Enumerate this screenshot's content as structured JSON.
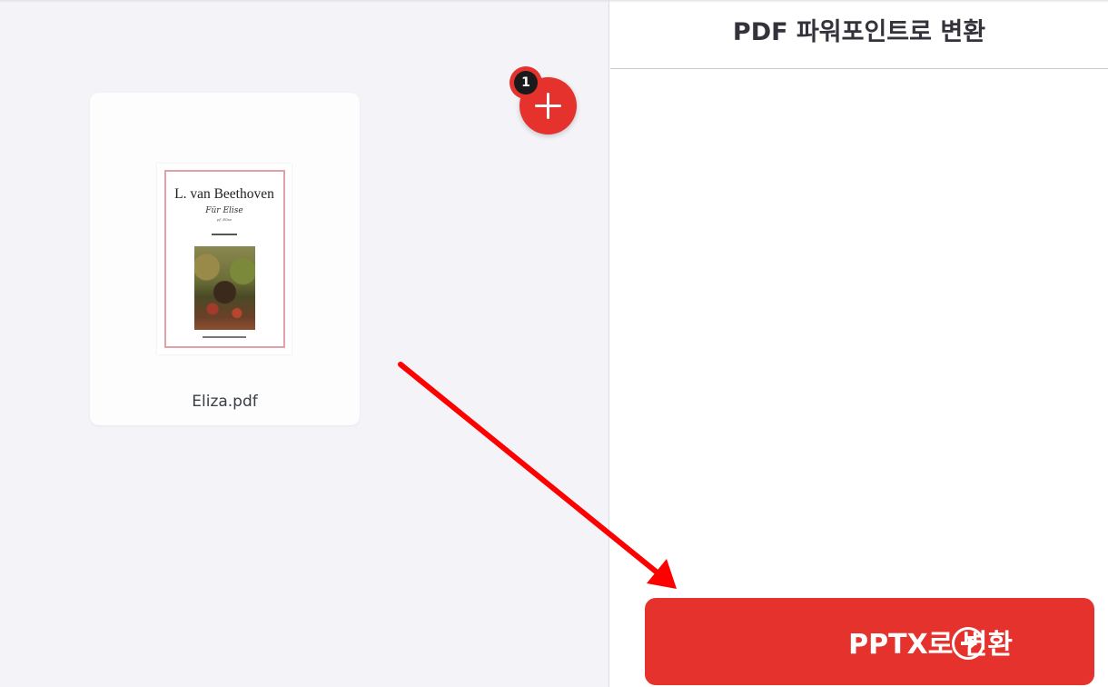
{
  "tool_title": "PDF 파워포인트로 변환",
  "files": [
    {
      "name": "Eliza.pdf",
      "thumbnail": {
        "title": "L. van Beethoven",
        "subtitle": "Für Elise",
        "sub_caption": "pf. Elise"
      }
    }
  ],
  "file_count": "1",
  "add_button_icon": "plus-icon",
  "convert_button": {
    "label": "PPTX로 변환",
    "icon": "arrow-right-circle-icon"
  },
  "colors": {
    "accent": "#e5322d",
    "annotation_arrow": "#ff0000",
    "left_pane_bg": "#f4f4f8"
  }
}
